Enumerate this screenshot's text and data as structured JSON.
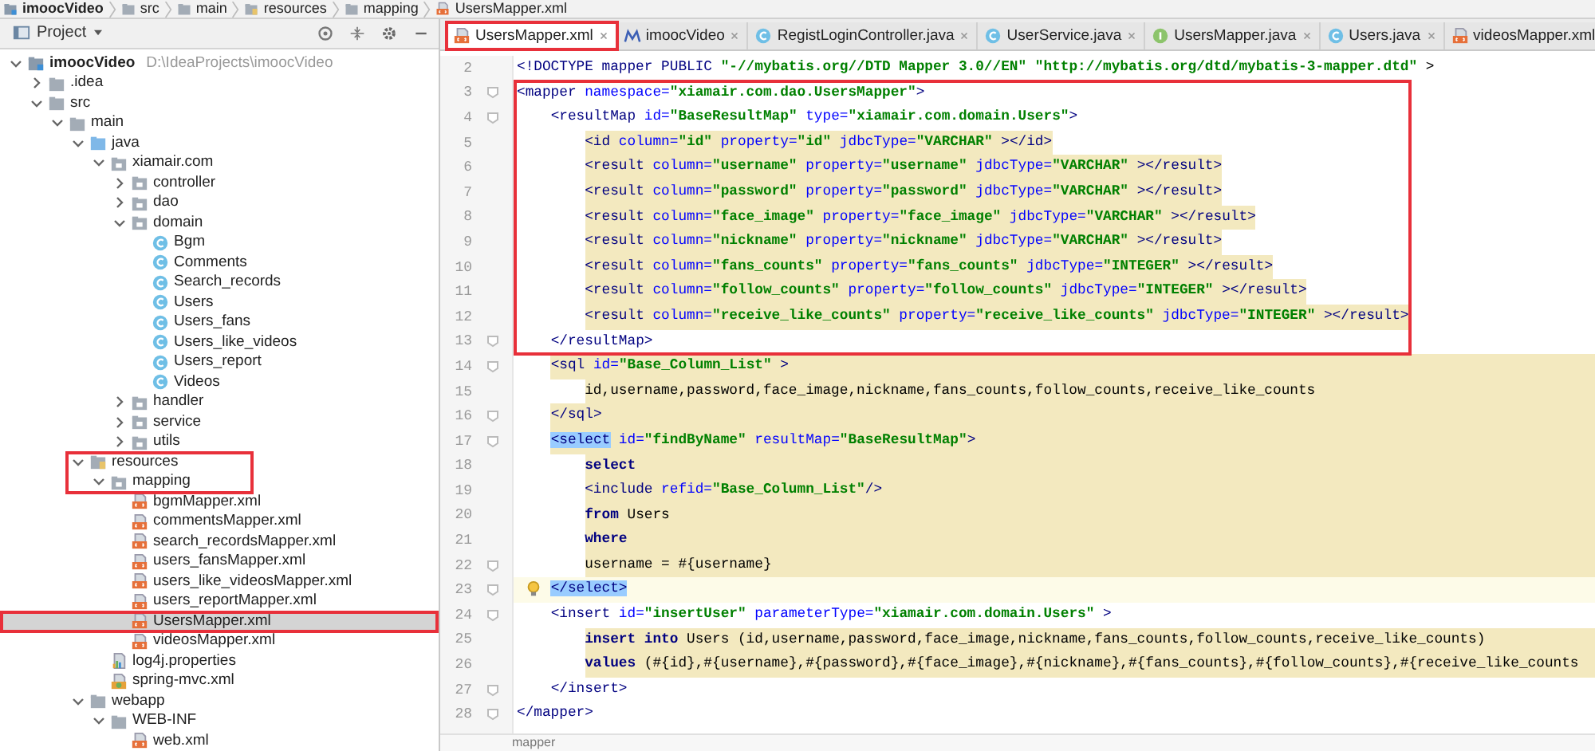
{
  "breadcrumb": [
    {
      "label": "imoocVideo",
      "kind": "module"
    },
    {
      "label": "src",
      "kind": "folder"
    },
    {
      "label": "main",
      "kind": "folder"
    },
    {
      "label": "resources",
      "kind": "resources"
    },
    {
      "label": "mapping",
      "kind": "folder"
    },
    {
      "label": "UsersMapper.xml",
      "kind": "xml"
    }
  ],
  "project_panel": {
    "title": "Project"
  },
  "project_tree": {
    "items": [
      {
        "label": "imoocVideo",
        "path": "D:\\IdeaProjects\\imoocVideo",
        "kind": "module",
        "expanded": true,
        "selected": false,
        "annotated": false,
        "children": [
          {
            "label": ".idea",
            "kind": "folder",
            "expanded": false,
            "selected": false,
            "annotated": false
          },
          {
            "label": "src",
            "kind": "folder",
            "expanded": true,
            "selected": false,
            "annotated": false,
            "children": [
              {
                "label": "main",
                "kind": "folder",
                "expanded": true,
                "selected": false,
                "annotated": false,
                "children": [
                  {
                    "label": "java",
                    "kind": "source",
                    "expanded": true,
                    "selected": false,
                    "annotated": false,
                    "children": [
                      {
                        "label": "xiamair.com",
                        "kind": "package",
                        "expanded": true,
                        "selected": false,
                        "annotated": false,
                        "children": [
                          {
                            "label": "controller",
                            "kind": "package",
                            "expanded": false,
                            "selected": false,
                            "annotated": false
                          },
                          {
                            "label": "dao",
                            "kind": "package",
                            "expanded": false,
                            "selected": false,
                            "annotated": false
                          },
                          {
                            "label": "domain",
                            "kind": "package",
                            "expanded": true,
                            "selected": false,
                            "annotated": false,
                            "children": [
                              {
                                "label": "Bgm",
                                "kind": "class",
                                "selected": false,
                                "annotated": false
                              },
                              {
                                "label": "Comments",
                                "kind": "class",
                                "selected": false,
                                "annotated": false
                              },
                              {
                                "label": "Search_records",
                                "kind": "class",
                                "selected": false,
                                "annotated": false
                              },
                              {
                                "label": "Users",
                                "kind": "class",
                                "selected": false,
                                "annotated": false
                              },
                              {
                                "label": "Users_fans",
                                "kind": "class",
                                "selected": false,
                                "annotated": false
                              },
                              {
                                "label": "Users_like_videos",
                                "kind": "class",
                                "selected": false,
                                "annotated": false
                              },
                              {
                                "label": "Users_report",
                                "kind": "class",
                                "selected": false,
                                "annotated": false
                              },
                              {
                                "label": "Videos",
                                "kind": "class",
                                "selected": false,
                                "annotated": false
                              }
                            ]
                          },
                          {
                            "label": "handler",
                            "kind": "package",
                            "expanded": false,
                            "selected": false,
                            "annotated": false
                          },
                          {
                            "label": "service",
                            "kind": "package",
                            "expanded": false,
                            "selected": false,
                            "annotated": false
                          },
                          {
                            "label": "utils",
                            "kind": "package",
                            "expanded": false,
                            "selected": false,
                            "annotated": false
                          }
                        ]
                      }
                    ]
                  },
                  {
                    "label": "resources",
                    "kind": "resources",
                    "expanded": true,
                    "selected": false,
                    "annotated": true,
                    "children": [
                      {
                        "label": "mapping",
                        "kind": "package",
                        "expanded": true,
                        "selected": false,
                        "annotated": true,
                        "children": [
                          {
                            "label": "bgmMapper.xml",
                            "kind": "xml",
                            "selected": false,
                            "annotated": false
                          },
                          {
                            "label": "commentsMapper.xml",
                            "kind": "xml",
                            "selected": false,
                            "annotated": false
                          },
                          {
                            "label": "search_recordsMapper.xml",
                            "kind": "xml",
                            "selected": false,
                            "annotated": false
                          },
                          {
                            "label": "users_fansMapper.xml",
                            "kind": "xml",
                            "selected": false,
                            "annotated": false
                          },
                          {
                            "label": "users_like_videosMapper.xml",
                            "kind": "xml",
                            "selected": false,
                            "annotated": false
                          },
                          {
                            "label": "users_reportMapper.xml",
                            "kind": "xml",
                            "selected": false,
                            "annotated": false
                          },
                          {
                            "label": "UsersMapper.xml",
                            "kind": "xml",
                            "selected": true,
                            "annotated": true
                          },
                          {
                            "label": "videosMapper.xml",
                            "kind": "xml",
                            "selected": false,
                            "annotated": false
                          }
                        ]
                      },
                      {
                        "label": "log4j.properties",
                        "kind": "properties",
                        "selected": false,
                        "annotated": false
                      },
                      {
                        "label": "spring-mvc.xml",
                        "kind": "spring",
                        "selected": false,
                        "annotated": false
                      }
                    ]
                  },
                  {
                    "label": "webapp",
                    "kind": "folder",
                    "expanded": true,
                    "selected": false,
                    "annotated": false,
                    "children": [
                      {
                        "label": "WEB-INF",
                        "kind": "folder",
                        "expanded": true,
                        "selected": false,
                        "annotated": false,
                        "children": [
                          {
                            "label": "web.xml",
                            "kind": "xml",
                            "selected": false,
                            "annotated": false
                          }
                        ]
                      }
                    ]
                  }
                ]
              }
            ]
          }
        ]
      }
    ]
  },
  "tabs": [
    {
      "label": "UsersMapper.xml",
      "kind": "xml",
      "selected": true,
      "annotated": true
    },
    {
      "label": "imoocVideo",
      "kind": "maven",
      "selected": false,
      "annotated": false
    },
    {
      "label": "RegistLoginController.java",
      "kind": "class",
      "selected": false,
      "annotated": false
    },
    {
      "label": "UserService.java",
      "kind": "class",
      "selected": false,
      "annotated": false
    },
    {
      "label": "UsersMapper.java",
      "kind": "interface",
      "selected": false,
      "annotated": false
    },
    {
      "label": "Users.java",
      "kind": "class",
      "selected": false,
      "annotated": false
    },
    {
      "label": "videosMapper.xml",
      "kind": "xml",
      "selected": false,
      "annotated": false
    }
  ],
  "code_lines": [
    {
      "number": "2",
      "highlighted": false,
      "full_width": false,
      "current": false,
      "fold": false,
      "bulb": false,
      "annotated": false,
      "tokens": [
        {
          "kind": "tag",
          "text": "<!DOCTYPE mapper PUBLIC "
        },
        {
          "kind": "string",
          "text": "\"-//mybatis.org//DTD Mapper 3.0//EN\""
        },
        {
          "kind": "string",
          "text": " \"http://mybatis.org/dtd/mybatis-3-mapper.dtd\""
        },
        {
          "kind": "text",
          "text": " >"
        }
      ]
    },
    {
      "number": "3",
      "highlighted": false,
      "full_width": false,
      "current": false,
      "fold": true,
      "bulb": false,
      "annotated": true,
      "tokens": [
        {
          "kind": "tag",
          "text": "<mapper"
        },
        {
          "kind": "attr",
          "text": " namespace="
        },
        {
          "kind": "string",
          "text": "\"xiamair.com.dao.UsersMapper\""
        },
        {
          "kind": "tag",
          "text": ">"
        }
      ]
    },
    {
      "number": "4",
      "highlighted": false,
      "full_width": false,
      "current": false,
      "fold": true,
      "bulb": false,
      "annotated": true,
      "tokens": [
        {
          "kind": "tag",
          "text": "    <resultMap"
        },
        {
          "kind": "attr",
          "text": " id="
        },
        {
          "kind": "string",
          "text": "\"BaseResultMap\""
        },
        {
          "kind": "attr",
          "text": " type="
        },
        {
          "kind": "string",
          "text": "\"xiamair.com.domain.Users\""
        },
        {
          "kind": "tag",
          "text": ">"
        }
      ]
    },
    {
      "number": "5",
      "highlighted": true,
      "full_width": false,
      "current": false,
      "fold": false,
      "bulb": false,
      "annotated": true,
      "tokens": [
        {
          "kind": "tag",
          "text": "        <id"
        },
        {
          "kind": "attr",
          "text": " column="
        },
        {
          "kind": "string",
          "text": "\"id\""
        },
        {
          "kind": "attr",
          "text": " property="
        },
        {
          "kind": "string",
          "text": "\"id\""
        },
        {
          "kind": "attr",
          "text": " jdbcType="
        },
        {
          "kind": "string",
          "text": "\"VARCHAR\""
        },
        {
          "kind": "tag",
          "text": " ></id>"
        }
      ]
    },
    {
      "number": "6",
      "highlighted": true,
      "full_width": false,
      "current": false,
      "fold": false,
      "bulb": false,
      "annotated": true,
      "tokens": [
        {
          "kind": "tag",
          "text": "        <result"
        },
        {
          "kind": "attr",
          "text": " column="
        },
        {
          "kind": "string",
          "text": "\"username\""
        },
        {
          "kind": "attr",
          "text": " property="
        },
        {
          "kind": "string",
          "text": "\"username\""
        },
        {
          "kind": "attr",
          "text": " jdbcType="
        },
        {
          "kind": "string",
          "text": "\"VARCHAR\""
        },
        {
          "kind": "tag",
          "text": " ></result>"
        }
      ]
    },
    {
      "number": "7",
      "highlighted": true,
      "full_width": false,
      "current": false,
      "fold": false,
      "bulb": false,
      "annotated": true,
      "tokens": [
        {
          "kind": "tag",
          "text": "        <result"
        },
        {
          "kind": "attr",
          "text": " column="
        },
        {
          "kind": "string",
          "text": "\"password\""
        },
        {
          "kind": "attr",
          "text": " property="
        },
        {
          "kind": "string",
          "text": "\"password\""
        },
        {
          "kind": "attr",
          "text": " jdbcType="
        },
        {
          "kind": "string",
          "text": "\"VARCHAR\""
        },
        {
          "kind": "tag",
          "text": " ></result>"
        }
      ]
    },
    {
      "number": "8",
      "highlighted": true,
      "full_width": false,
      "current": false,
      "fold": false,
      "bulb": false,
      "annotated": true,
      "tokens": [
        {
          "kind": "tag",
          "text": "        <result"
        },
        {
          "kind": "attr",
          "text": " column="
        },
        {
          "kind": "string",
          "text": "\"face_image\""
        },
        {
          "kind": "attr",
          "text": " property="
        },
        {
          "kind": "string",
          "text": "\"face_image\""
        },
        {
          "kind": "attr",
          "text": " jdbcType="
        },
        {
          "kind": "string",
          "text": "\"VARCHAR\""
        },
        {
          "kind": "tag",
          "text": " ></result>"
        }
      ]
    },
    {
      "number": "9",
      "highlighted": true,
      "full_width": false,
      "current": false,
      "fold": false,
      "bulb": false,
      "annotated": true,
      "tokens": [
        {
          "kind": "tag",
          "text": "        <result"
        },
        {
          "kind": "attr",
          "text": " column="
        },
        {
          "kind": "string",
          "text": "\"nickname\""
        },
        {
          "kind": "attr",
          "text": " property="
        },
        {
          "kind": "string",
          "text": "\"nickname\""
        },
        {
          "kind": "attr",
          "text": " jdbcType="
        },
        {
          "kind": "string",
          "text": "\"VARCHAR\""
        },
        {
          "kind": "tag",
          "text": " ></result>"
        }
      ]
    },
    {
      "number": "10",
      "highlighted": true,
      "full_width": false,
      "current": false,
      "fold": false,
      "bulb": false,
      "annotated": true,
      "tokens": [
        {
          "kind": "tag",
          "text": "        <result"
        },
        {
          "kind": "attr",
          "text": " column="
        },
        {
          "kind": "string",
          "text": "\"fans_counts\""
        },
        {
          "kind": "attr",
          "text": " property="
        },
        {
          "kind": "string",
          "text": "\"fans_counts\""
        },
        {
          "kind": "attr",
          "text": " jdbcType="
        },
        {
          "kind": "string",
          "text": "\"INTEGER\""
        },
        {
          "kind": "tag",
          "text": " ></result>"
        }
      ]
    },
    {
      "number": "11",
      "highlighted": true,
      "full_width": false,
      "current": false,
      "fold": false,
      "bulb": false,
      "annotated": true,
      "tokens": [
        {
          "kind": "tag",
          "text": "        <result"
        },
        {
          "kind": "attr",
          "text": " column="
        },
        {
          "kind": "string",
          "text": "\"follow_counts\""
        },
        {
          "kind": "attr",
          "text": " property="
        },
        {
          "kind": "string",
          "text": "\"follow_counts\""
        },
        {
          "kind": "attr",
          "text": " jdbcType="
        },
        {
          "kind": "string",
          "text": "\"INTEGER\""
        },
        {
          "kind": "tag",
          "text": " ></result>"
        }
      ]
    },
    {
      "number": "12",
      "highlighted": true,
      "full_width": false,
      "current": false,
      "fold": false,
      "bulb": false,
      "annotated": true,
      "tokens": [
        {
          "kind": "tag",
          "text": "        <result"
        },
        {
          "kind": "attr",
          "text": " column="
        },
        {
          "kind": "string",
          "text": "\"receive_like_counts\""
        },
        {
          "kind": "attr",
          "text": " property="
        },
        {
          "kind": "string",
          "text": "\"receive_like_counts\""
        },
        {
          "kind": "attr",
          "text": " jdbcType="
        },
        {
          "kind": "string",
          "text": "\"INTEGER\""
        },
        {
          "kind": "tag",
          "text": " ></result>"
        }
      ]
    },
    {
      "number": "13",
      "highlighted": false,
      "full_width": false,
      "current": false,
      "fold": true,
      "bulb": false,
      "annotated": true,
      "tokens": [
        {
          "kind": "tag",
          "text": "    </resultMap>"
        }
      ]
    },
    {
      "number": "14",
      "highlighted": true,
      "full_width": true,
      "current": false,
      "fold": true,
      "bulb": false,
      "annotated": false,
      "tokens": [
        {
          "kind": "tag",
          "text": "    <sql"
        },
        {
          "kind": "attr",
          "text": " id="
        },
        {
          "kind": "string",
          "text": "\"Base_Column_List\""
        },
        {
          "kind": "tag",
          "text": " >"
        }
      ]
    },
    {
      "number": "15",
      "highlighted": true,
      "full_width": true,
      "current": false,
      "fold": false,
      "bulb": false,
      "annotated": false,
      "tokens": [
        {
          "kind": "text",
          "text": "        id,username,password,face_image,nickname,fans_counts,follow_counts,receive_like_counts"
        }
      ]
    },
    {
      "number": "16",
      "highlighted": true,
      "full_width": true,
      "current": false,
      "fold": true,
      "bulb": false,
      "annotated": false,
      "tokens": [
        {
          "kind": "tag",
          "text": "    </sql>"
        }
      ]
    },
    {
      "number": "17",
      "highlighted": true,
      "full_width": true,
      "current": false,
      "fold": true,
      "bulb": false,
      "annotated": false,
      "tokens": [
        {
          "kind": "matched-tag",
          "text": "    <select"
        },
        {
          "kind": "attr",
          "text": " id="
        },
        {
          "kind": "string",
          "text": "\"findByName\""
        },
        {
          "kind": "attr",
          "text": " resultMap="
        },
        {
          "kind": "string",
          "text": "\"BaseResultMap\""
        },
        {
          "kind": "tag",
          "text": ">"
        }
      ]
    },
    {
      "number": "18",
      "highlighted": true,
      "full_width": true,
      "current": false,
      "fold": false,
      "bulb": false,
      "annotated": false,
      "tokens": [
        {
          "kind": "keyword",
          "text": "        select"
        }
      ]
    },
    {
      "number": "19",
      "highlighted": true,
      "full_width": true,
      "current": false,
      "fold": false,
      "bulb": false,
      "annotated": false,
      "tokens": [
        {
          "kind": "tag",
          "text": "        <include"
        },
        {
          "kind": "attr",
          "text": " refid="
        },
        {
          "kind": "string",
          "text": "\"Base_Column_List\""
        },
        {
          "kind": "tag",
          "text": "/>"
        }
      ]
    },
    {
      "number": "20",
      "highlighted": true,
      "full_width": true,
      "current": false,
      "fold": false,
      "bulb": false,
      "annotated": false,
      "tokens": [
        {
          "kind": "keyword",
          "text": "        from"
        },
        {
          "kind": "text",
          "text": " Users"
        }
      ]
    },
    {
      "number": "21",
      "highlighted": true,
      "full_width": true,
      "current": false,
      "fold": false,
      "bulb": false,
      "annotated": false,
      "tokens": [
        {
          "kind": "keyword",
          "text": "        where"
        }
      ]
    },
    {
      "number": "22",
      "highlighted": true,
      "full_width": true,
      "current": false,
      "fold": true,
      "bulb": false,
      "annotated": false,
      "tokens": [
        {
          "kind": "text",
          "text": "        username = #{username}"
        }
      ]
    },
    {
      "number": "23",
      "highlighted": false,
      "full_width": false,
      "current": true,
      "fold": true,
      "bulb": true,
      "annotated": false,
      "tokens": [
        {
          "kind": "matched-tag",
          "text": "    </select>"
        }
      ]
    },
    {
      "number": "24",
      "highlighted": false,
      "full_width": false,
      "current": false,
      "fold": true,
      "bulb": false,
      "annotated": false,
      "tokens": [
        {
          "kind": "tag",
          "text": "    <insert"
        },
        {
          "kind": "attr",
          "text": " id="
        },
        {
          "kind": "string",
          "text": "\"insertUser\""
        },
        {
          "kind": "attr",
          "text": " parameterType="
        },
        {
          "kind": "string",
          "text": "\"xiamair.com.domain.Users\""
        },
        {
          "kind": "tag",
          "text": " >"
        }
      ]
    },
    {
      "number": "25",
      "highlighted": true,
      "full_width": true,
      "current": false,
      "fold": false,
      "bulb": false,
      "annotated": false,
      "tokens": [
        {
          "kind": "keyword",
          "text": "        insert into"
        },
        {
          "kind": "text",
          "text": " Users (id,username,password,face_image,nickname,fans_counts,follow_counts,receive_like_counts)"
        }
      ]
    },
    {
      "number": "26",
      "highlighted": true,
      "full_width": true,
      "current": false,
      "fold": false,
      "bulb": false,
      "annotated": false,
      "tokens": [
        {
          "kind": "keyword",
          "text": "        values"
        },
        {
          "kind": "text",
          "text": " (#{id},#{username},#{password},#{face_image},#{nickname},#{fans_counts},#{follow_counts},#{receive_like_counts"
        }
      ]
    },
    {
      "number": "27",
      "highlighted": false,
      "full_width": false,
      "current": false,
      "fold": true,
      "bulb": false,
      "annotated": false,
      "tokens": [
        {
          "kind": "tag",
          "text": "    </insert>"
        }
      ]
    },
    {
      "number": "28",
      "highlighted": false,
      "full_width": false,
      "current": false,
      "fold": true,
      "bulb": false,
      "annotated": false,
      "tokens": [
        {
          "kind": "tag",
          "text": "</mapper>"
        }
      ]
    }
  ],
  "editor_breadcrumb": "mapper"
}
